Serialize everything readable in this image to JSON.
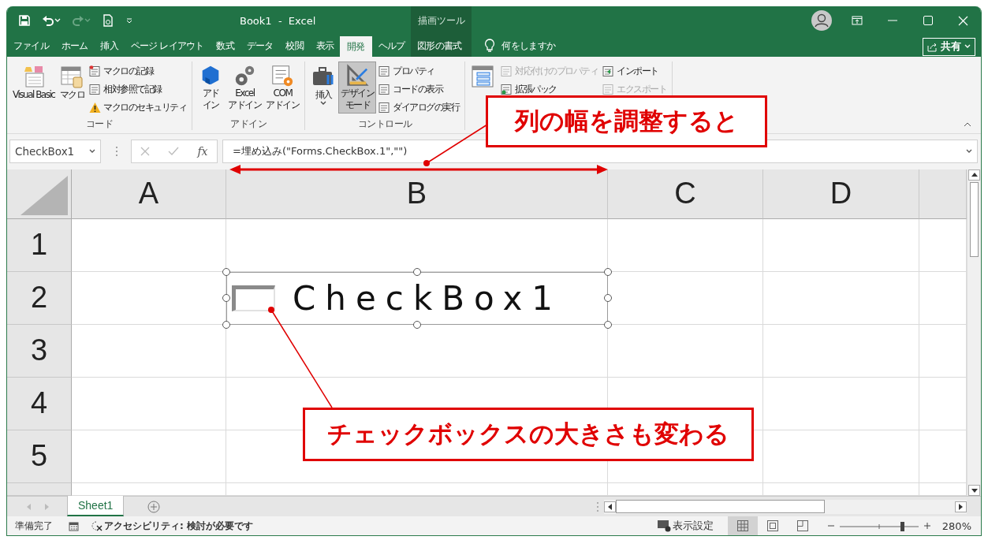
{
  "title": "Book1  -  Excel",
  "context_header": "描画ツール",
  "ribbon_tabs": [
    {
      "label": "ファイル",
      "kind": "standard",
      "selected": false
    },
    {
      "label": "ホーム",
      "kind": "standard",
      "selected": false
    },
    {
      "label": "挿入",
      "kind": "standard",
      "selected": false
    },
    {
      "label": "ページ レイアウト",
      "kind": "standard",
      "selected": false
    },
    {
      "label": "数式",
      "kind": "standard",
      "selected": false
    },
    {
      "label": "データ",
      "kind": "standard",
      "selected": false
    },
    {
      "label": "校閲",
      "kind": "standard",
      "selected": false
    },
    {
      "label": "表示",
      "kind": "standard",
      "selected": false
    },
    {
      "label": "開発",
      "kind": "standard",
      "selected": true
    },
    {
      "label": "ヘルプ",
      "kind": "standard",
      "selected": false
    },
    {
      "label": "図形の書式",
      "kind": "contextual",
      "selected": false
    }
  ],
  "tell_me": "何をしますか",
  "share": "共有",
  "ribbon_groups": [
    {
      "label": "コード",
      "items": [
        {
          "kind": "large",
          "lines": [
            "Visual Basic"
          ],
          "pressed": false,
          "dropdown": false
        },
        {
          "kind": "large",
          "lines": [
            "マクロ"
          ],
          "pressed": false,
          "dropdown": false
        },
        {
          "kind": "stack",
          "entries": [
            {
              "label": "マクロの記録",
              "disabled": false
            },
            {
              "label": "相対参照で記録",
              "disabled": false
            },
            {
              "label": "マクロのセキュリティ",
              "disabled": false
            }
          ]
        }
      ]
    },
    {
      "label": "アドイン",
      "items": [
        {
          "kind": "large",
          "lines": [
            "アド",
            "イン"
          ],
          "pressed": false,
          "dropdown": false
        },
        {
          "kind": "large",
          "lines": [
            "Excel",
            "アドイン"
          ],
          "pressed": false,
          "dropdown": false
        },
        {
          "kind": "large",
          "lines": [
            "COM",
            "アドイン"
          ],
          "pressed": false,
          "dropdown": false
        }
      ]
    },
    {
      "label": "コントロール",
      "items": [
        {
          "kind": "large",
          "lines": [
            "挿入"
          ],
          "pressed": false,
          "dropdown": true
        },
        {
          "kind": "large",
          "lines": [
            "デザイン",
            "モード"
          ],
          "pressed": true,
          "dropdown": false
        },
        {
          "kind": "stack",
          "entries": [
            {
              "label": "プロパティ",
              "disabled": false
            },
            {
              "label": "コードの表示",
              "disabled": false
            },
            {
              "label": "ダイアログの実行",
              "disabled": false
            }
          ]
        }
      ]
    },
    {
      "items": [
        {
          "kind": "large",
          "pressed": false,
          "dropdown": false
        },
        {
          "kind": "stack",
          "entries": [
            {
              "label": "対応付けのプロパティ",
              "disabled": true
            },
            {
              "label": "拡張パック",
              "disabled": false
            }
          ]
        },
        {
          "kind": "stack",
          "entries": [
            {
              "label": "インポート",
              "disabled": false
            },
            {
              "label": "エクスポート",
              "disabled": true
            }
          ]
        }
      ]
    }
  ],
  "name_box": "CheckBox1",
  "function_button": "fx",
  "formula": "=埋め込み(\"Forms.CheckBox.1\",\"\")",
  "columns": [
    "A",
    "B",
    "C",
    "D"
  ],
  "rows": [
    "1",
    "2",
    "3",
    "4",
    "5"
  ],
  "checkbox": {
    "label": "CheckBox1",
    "checked": false
  },
  "sheet_tabs": [
    {
      "label": "Sheet1",
      "selected": true
    }
  ],
  "status": {
    "ready": "準備完了",
    "accessibility": "アクセシビリティ: 検討が必要です",
    "display_settings": "表示設定",
    "views": [
      {
        "kind": "normal",
        "selected": true
      },
      {
        "kind": "page_layout",
        "selected": false
      },
      {
        "kind": "page_break",
        "selected": false
      }
    ],
    "zoom_slider": {
      "level": 0.79
    },
    "zoom": "280%"
  },
  "annotations": [
    {
      "text": "列の幅を調整すると"
    },
    {
      "text": "チェックボックスの大きさも変わる"
    }
  ]
}
